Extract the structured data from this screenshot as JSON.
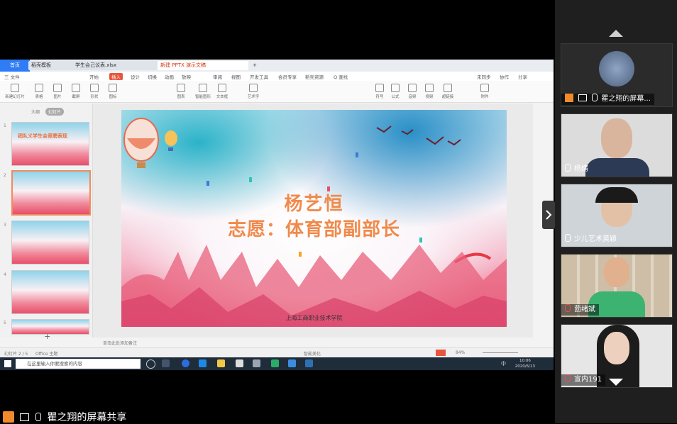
{
  "tabs": {
    "brand": "首页",
    "items": [
      "稻壳模板",
      "学生会己议表.xlsx",
      "新建 PPTX 演示文稿"
    ]
  },
  "menu": {
    "items": [
      "三 文件",
      "开始",
      "插入",
      "设计",
      "切换",
      "动画",
      "放映",
      "审阅",
      "视图",
      "开发工具",
      "会员专享",
      "稻壳资源",
      "Q 查找"
    ],
    "active_index": 2,
    "right": [
      "未同步",
      "协作",
      "分享"
    ]
  },
  "toolbar": {
    "items": [
      "新建幻灯片",
      "表格",
      "图片",
      "截屏",
      "形状",
      "图标",
      "图表",
      "智能图形",
      "文本框",
      "艺术字",
      "符号",
      "公式",
      "音频",
      "视频",
      "超链接",
      "附件"
    ]
  },
  "thumbs": {
    "tabs": [
      "大纲",
      "幻灯片"
    ],
    "numbers": [
      "1",
      "2",
      "3",
      "4",
      "5"
    ],
    "first_title": "团队义学生会竞聘表现",
    "add_label": "+"
  },
  "slide": {
    "title_line1": "杨艺恒",
    "title_line2": "志愿：体育部副部长",
    "footer": "上海工商职业技术学院"
  },
  "notes": {
    "placeholder": "单击此处添加备注"
  },
  "status": {
    "left": "幻灯片 2 / 5",
    "theme": "Office 主题",
    "center": "智能美化",
    "zoom": "84%"
  },
  "taskbar": {
    "search_placeholder": "在这里输入你要搜索的内容",
    "time": "10:06",
    "date": "2020/6/13",
    "lang": "中"
  },
  "participants": [
    {
      "name": "瞿之翔的屏幕...",
      "kind": "avatar"
    },
    {
      "name": "杨婧",
      "kind": "video"
    },
    {
      "name": "少儿艺术黄颖",
      "kind": "video"
    },
    {
      "name": "茴绪斌",
      "kind": "video"
    },
    {
      "name": "宣内191",
      "kind": "video"
    }
  ],
  "share_label": "瞿之翔的屏幕共享",
  "colors": {
    "accent": "#e8543d",
    "title": "#f08a4b",
    "share_icon": "#f08a2a"
  }
}
